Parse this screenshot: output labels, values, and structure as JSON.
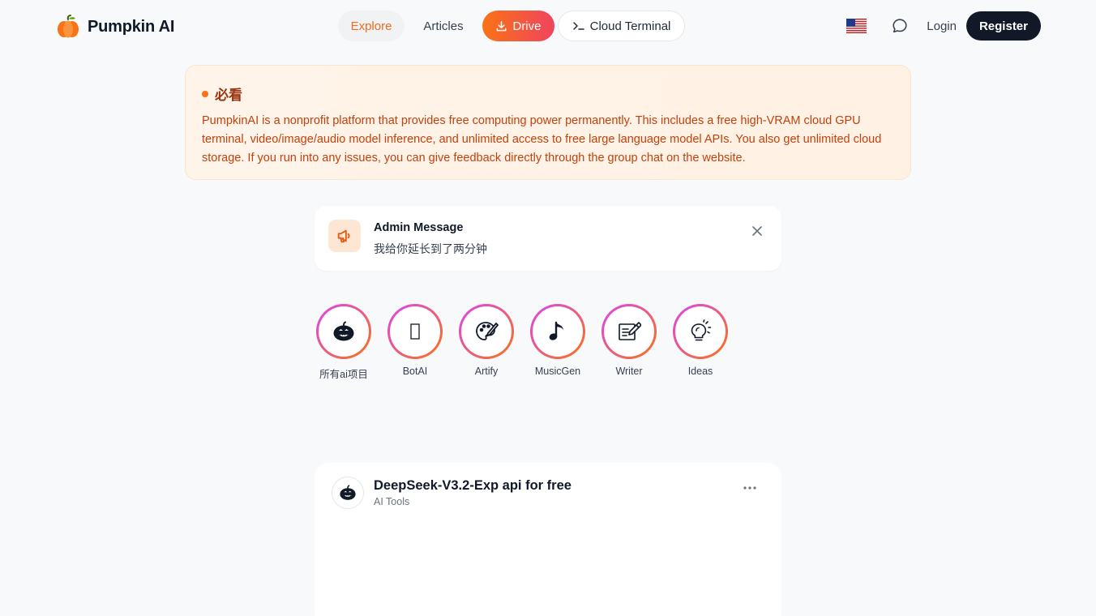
{
  "header": {
    "logo_text": "Pumpkin AI",
    "nav": {
      "explore": "Explore",
      "articles": "Articles",
      "drive": "Drive",
      "cloud_terminal": "Cloud Terminal"
    },
    "login": "Login",
    "register": "Register"
  },
  "notice": {
    "title": "必看",
    "body": "PumpkinAI is a nonprofit platform that provides free computing power permanently. This includes a free high-VRAM cloud GPU terminal, video/image/audio model inference, and unlimited access to free large language model APIs. You also get unlimited cloud storage. If you run into any issues, you can give feedback directly through the group chat on the website."
  },
  "admin_message": {
    "title": "Admin Message",
    "text": "我给你延长到了两分钟"
  },
  "apps": [
    {
      "label": "所有ai项目",
      "icon": "pumpkin-icon"
    },
    {
      "label": "BotAI",
      "icon": "bot-icon"
    },
    {
      "label": "Artify",
      "icon": "palette-icon"
    },
    {
      "label": "MusicGen",
      "icon": "music-note-icon"
    },
    {
      "label": "Writer",
      "icon": "writing-icon"
    },
    {
      "label": "Ideas",
      "icon": "lightbulb-icon"
    }
  ],
  "post": {
    "title": "DeepSeek-V3.2-Exp api for free",
    "category": "AI Tools"
  },
  "colors": {
    "accent": "#f97316",
    "accent_pink": "#f0445e",
    "dark": "#111827"
  }
}
